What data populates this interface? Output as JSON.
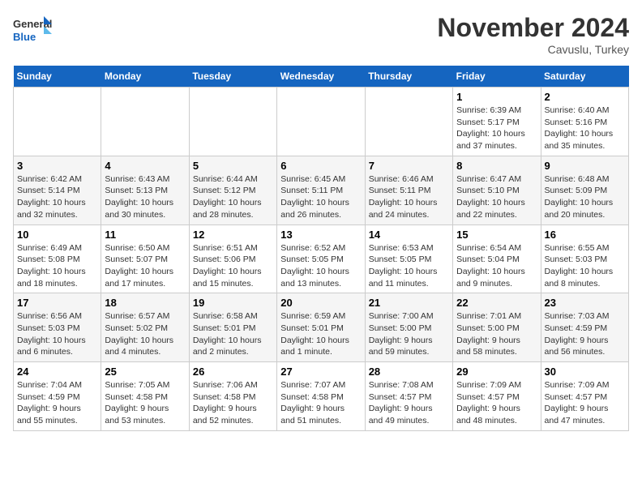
{
  "header": {
    "logo_line1": "General",
    "logo_line2": "Blue",
    "month_title": "November 2024",
    "subtitle": "Cavuslu, Turkey"
  },
  "weekdays": [
    "Sunday",
    "Monday",
    "Tuesday",
    "Wednesday",
    "Thursday",
    "Friday",
    "Saturday"
  ],
  "weeks": [
    [
      {
        "day": "",
        "info": ""
      },
      {
        "day": "",
        "info": ""
      },
      {
        "day": "",
        "info": ""
      },
      {
        "day": "",
        "info": ""
      },
      {
        "day": "",
        "info": ""
      },
      {
        "day": "1",
        "info": "Sunrise: 6:39 AM\nSunset: 5:17 PM\nDaylight: 10 hours\nand 37 minutes."
      },
      {
        "day": "2",
        "info": "Sunrise: 6:40 AM\nSunset: 5:16 PM\nDaylight: 10 hours\nand 35 minutes."
      }
    ],
    [
      {
        "day": "3",
        "info": "Sunrise: 6:42 AM\nSunset: 5:14 PM\nDaylight: 10 hours\nand 32 minutes."
      },
      {
        "day": "4",
        "info": "Sunrise: 6:43 AM\nSunset: 5:13 PM\nDaylight: 10 hours\nand 30 minutes."
      },
      {
        "day": "5",
        "info": "Sunrise: 6:44 AM\nSunset: 5:12 PM\nDaylight: 10 hours\nand 28 minutes."
      },
      {
        "day": "6",
        "info": "Sunrise: 6:45 AM\nSunset: 5:11 PM\nDaylight: 10 hours\nand 26 minutes."
      },
      {
        "day": "7",
        "info": "Sunrise: 6:46 AM\nSunset: 5:11 PM\nDaylight: 10 hours\nand 24 minutes."
      },
      {
        "day": "8",
        "info": "Sunrise: 6:47 AM\nSunset: 5:10 PM\nDaylight: 10 hours\nand 22 minutes."
      },
      {
        "day": "9",
        "info": "Sunrise: 6:48 AM\nSunset: 5:09 PM\nDaylight: 10 hours\nand 20 minutes."
      }
    ],
    [
      {
        "day": "10",
        "info": "Sunrise: 6:49 AM\nSunset: 5:08 PM\nDaylight: 10 hours\nand 18 minutes."
      },
      {
        "day": "11",
        "info": "Sunrise: 6:50 AM\nSunset: 5:07 PM\nDaylight: 10 hours\nand 17 minutes."
      },
      {
        "day": "12",
        "info": "Sunrise: 6:51 AM\nSunset: 5:06 PM\nDaylight: 10 hours\nand 15 minutes."
      },
      {
        "day": "13",
        "info": "Sunrise: 6:52 AM\nSunset: 5:05 PM\nDaylight: 10 hours\nand 13 minutes."
      },
      {
        "day": "14",
        "info": "Sunrise: 6:53 AM\nSunset: 5:05 PM\nDaylight: 10 hours\nand 11 minutes."
      },
      {
        "day": "15",
        "info": "Sunrise: 6:54 AM\nSunset: 5:04 PM\nDaylight: 10 hours\nand 9 minutes."
      },
      {
        "day": "16",
        "info": "Sunrise: 6:55 AM\nSunset: 5:03 PM\nDaylight: 10 hours\nand 8 minutes."
      }
    ],
    [
      {
        "day": "17",
        "info": "Sunrise: 6:56 AM\nSunset: 5:03 PM\nDaylight: 10 hours\nand 6 minutes."
      },
      {
        "day": "18",
        "info": "Sunrise: 6:57 AM\nSunset: 5:02 PM\nDaylight: 10 hours\nand 4 minutes."
      },
      {
        "day": "19",
        "info": "Sunrise: 6:58 AM\nSunset: 5:01 PM\nDaylight: 10 hours\nand 2 minutes."
      },
      {
        "day": "20",
        "info": "Sunrise: 6:59 AM\nSunset: 5:01 PM\nDaylight: 10 hours\nand 1 minute."
      },
      {
        "day": "21",
        "info": "Sunrise: 7:00 AM\nSunset: 5:00 PM\nDaylight: 9 hours\nand 59 minutes."
      },
      {
        "day": "22",
        "info": "Sunrise: 7:01 AM\nSunset: 5:00 PM\nDaylight: 9 hours\nand 58 minutes."
      },
      {
        "day": "23",
        "info": "Sunrise: 7:03 AM\nSunset: 4:59 PM\nDaylight: 9 hours\nand 56 minutes."
      }
    ],
    [
      {
        "day": "24",
        "info": "Sunrise: 7:04 AM\nSunset: 4:59 PM\nDaylight: 9 hours\nand 55 minutes."
      },
      {
        "day": "25",
        "info": "Sunrise: 7:05 AM\nSunset: 4:58 PM\nDaylight: 9 hours\nand 53 minutes."
      },
      {
        "day": "26",
        "info": "Sunrise: 7:06 AM\nSunset: 4:58 PM\nDaylight: 9 hours\nand 52 minutes."
      },
      {
        "day": "27",
        "info": "Sunrise: 7:07 AM\nSunset: 4:58 PM\nDaylight: 9 hours\nand 51 minutes."
      },
      {
        "day": "28",
        "info": "Sunrise: 7:08 AM\nSunset: 4:57 PM\nDaylight: 9 hours\nand 49 minutes."
      },
      {
        "day": "29",
        "info": "Sunrise: 7:09 AM\nSunset: 4:57 PM\nDaylight: 9 hours\nand 48 minutes."
      },
      {
        "day": "30",
        "info": "Sunrise: 7:09 AM\nSunset: 4:57 PM\nDaylight: 9 hours\nand 47 minutes."
      }
    ]
  ]
}
